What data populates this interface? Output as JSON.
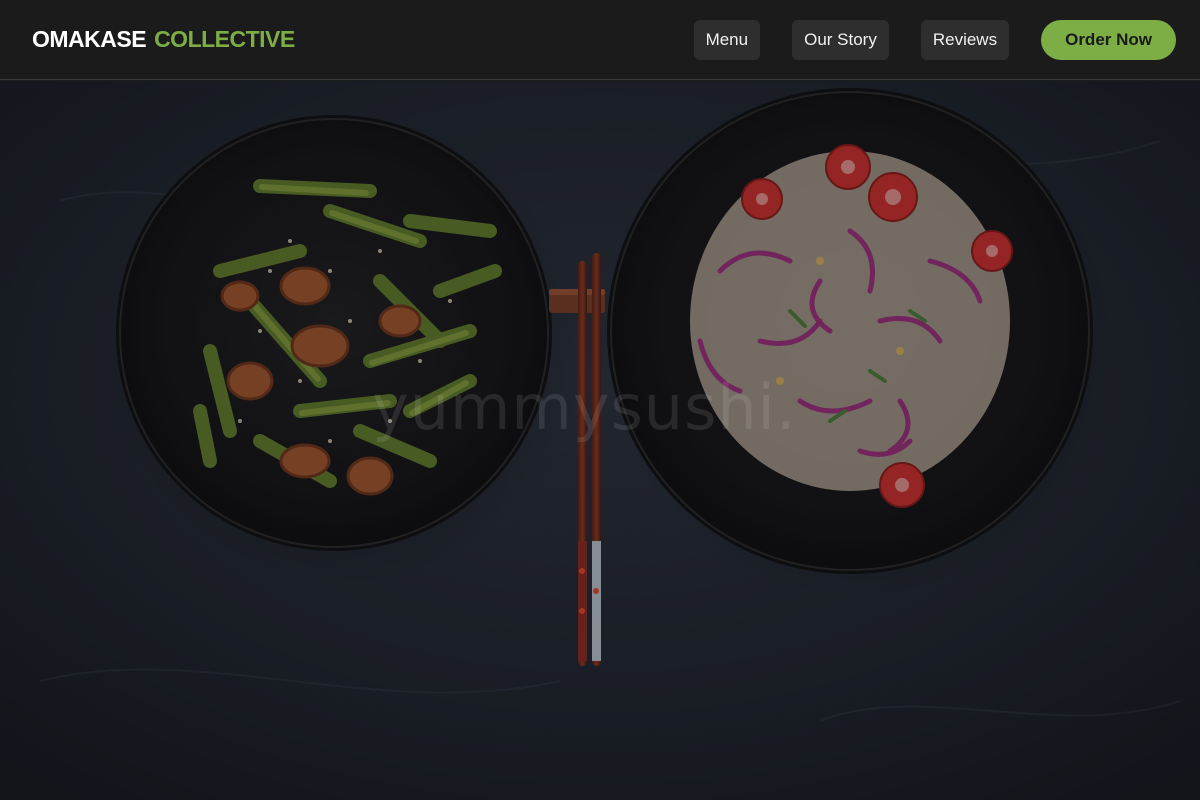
{
  "brand": {
    "word1": "OMAKASE",
    "word2": "COLLECTIVE"
  },
  "nav": {
    "items": [
      {
        "label": "Menu"
      },
      {
        "label": "Our Story"
      },
      {
        "label": "Reviews"
      }
    ],
    "cta_label": "Order Now"
  },
  "hero": {
    "watermark": "yummysushi.",
    "image_alt": "Two dark bowls with stir-fried shrimp and celery and a purple cabbage slaw with cherry tomatoes, chopsticks between them"
  },
  "colors": {
    "accent": "#7cae45",
    "topbar_bg": "#1b1b1b",
    "nav_button_bg": "#2e2e2e",
    "hero_bg": "#20262f"
  }
}
